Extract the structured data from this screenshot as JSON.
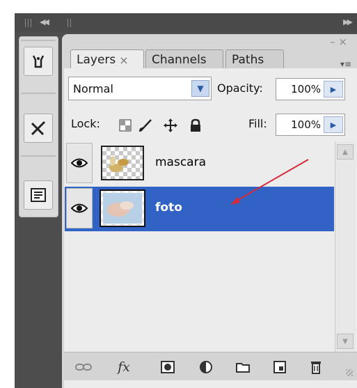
{
  "tabs": [
    {
      "label": "Layers",
      "close": "×"
    },
    {
      "label": "Channels"
    },
    {
      "label": "Paths"
    }
  ],
  "blend_mode": {
    "value": "Normal"
  },
  "opacity": {
    "label": "Opacity:",
    "value": "100%"
  },
  "lock": {
    "label": "Lock:"
  },
  "fill": {
    "label": "Fill:",
    "value": "100%"
  },
  "layers": [
    {
      "name": "mascara",
      "selected": false
    },
    {
      "name": "foto",
      "selected": true
    }
  ],
  "colors": {
    "selection": "#3163c5",
    "arrow": "#d42c3c",
    "panel": "#ececec"
  },
  "icons": {
    "dock": [
      "tools-icon",
      "brush-presets-icon",
      "info-icon"
    ],
    "bottom": [
      "link-icon",
      "fx-icon",
      "mask-icon",
      "adjustment-icon",
      "folder-icon",
      "new-layer-icon",
      "trash-icon"
    ],
    "lock": [
      "lock-transparency-icon",
      "lock-paint-icon",
      "lock-move-icon",
      "lock-all-icon"
    ]
  },
  "fx_label": "fx"
}
